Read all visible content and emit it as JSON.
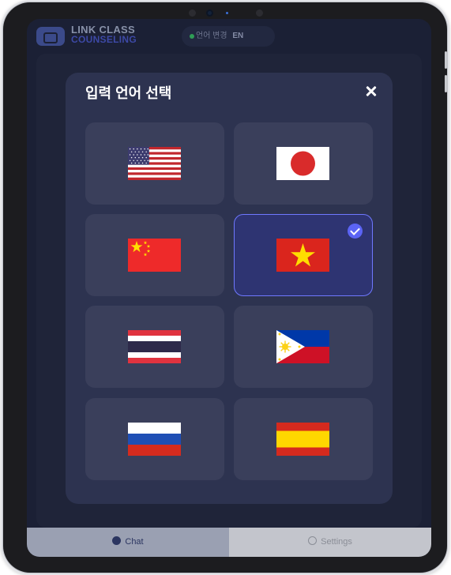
{
  "app": {
    "brand_line1": "LINK CLASS",
    "brand_line2": "COUNSELING",
    "language_pill_label": "언어 변경",
    "language_pill_code": "EN"
  },
  "tabs": {
    "chat": "Chat",
    "settings": "Settings"
  },
  "modal": {
    "title": "입력 언어 선택",
    "selected_language": "vietnamese",
    "languages": [
      {
        "id": "english",
        "flag": "us-flag-icon"
      },
      {
        "id": "japanese",
        "flag": "japan-flag-icon"
      },
      {
        "id": "chinese",
        "flag": "china-flag-icon"
      },
      {
        "id": "vietnamese",
        "flag": "vietnam-flag-icon",
        "selected": true
      },
      {
        "id": "thai",
        "flag": "thailand-flag-icon"
      },
      {
        "id": "filipino",
        "flag": "philippines-flag-icon"
      },
      {
        "id": "russian",
        "flag": "russia-flag-icon"
      },
      {
        "id": "spanish",
        "flag": "spain-flag-icon"
      }
    ]
  },
  "colors": {
    "overlay_background": "#1b2035",
    "modal_background": "#2d3350",
    "card_background": "#3a3f5b",
    "selected_card_background": "#2e3472",
    "selected_border": "#6f78ff",
    "check_badge": "#5b64f5"
  }
}
